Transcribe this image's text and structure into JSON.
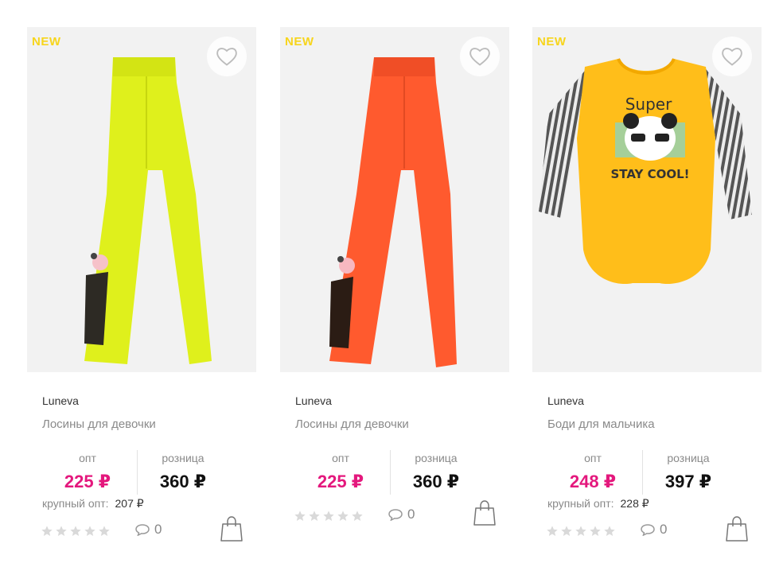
{
  "colors": {
    "badge": "#f7d51c",
    "opt_price": "#e4187d",
    "retail_price": "#111111",
    "card_bg": "#f2f2f2"
  },
  "products": [
    {
      "badge": "NEW",
      "brand": "Luneva",
      "title": "Лосины для девочки",
      "opt_label": "опт",
      "opt_price": "225 ₽",
      "retail_label": "розница",
      "retail_price": "360 ₽",
      "bulk_label": "крупный опт:",
      "bulk_price": "207 ₽",
      "rating": 0,
      "comments": "0",
      "image": "yellow-leggings-giraffe"
    },
    {
      "badge": "NEW",
      "brand": "Luneva",
      "title": "Лосины для девочки",
      "opt_label": "опт",
      "opt_price": "225 ₽",
      "retail_label": "розница",
      "retail_price": "360 ₽",
      "rating": 0,
      "comments": "0",
      "image": "orange-leggings-giraffe"
    },
    {
      "badge": "NEW",
      "brand": "Luneva",
      "title": "Боди для мальчика",
      "opt_label": "опт",
      "opt_price": "248 ₽",
      "retail_label": "розница",
      "retail_price": "397 ₽",
      "bulk_label": "крупный опт:",
      "bulk_price": "228 ₽",
      "rating": 0,
      "comments": "0",
      "image": "yellow-bodysuit-panda",
      "print_text_top": "Super",
      "print_text_bottom": "STAY COOL!"
    }
  ]
}
